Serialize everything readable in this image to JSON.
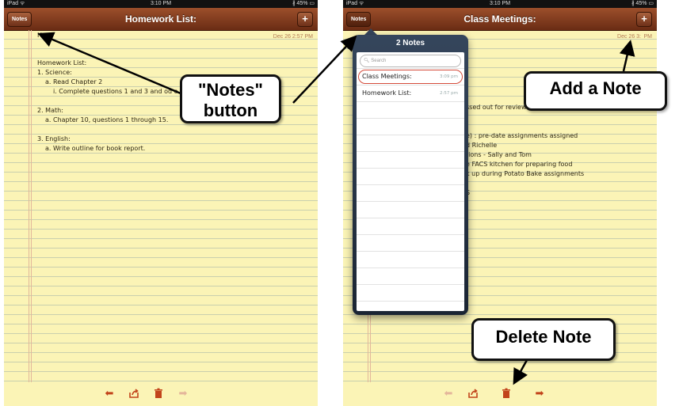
{
  "status": {
    "carrier": "iPad ᯤ",
    "time": "3:10 PM",
    "battery": "∦ 45% ▭"
  },
  "left": {
    "title": "Homework List:",
    "notes_button": "Notes",
    "add_button": "+",
    "date": "Dec 26  2:57 PM",
    "first_line": "H",
    "lines": [
      {
        "text": "Homework List:",
        "indent": 0
      },
      {
        "text": "1. Science:",
        "indent": 0
      },
      {
        "text": "a. Read Chapter 2",
        "indent": 1
      },
      {
        "text": "i. Complete questions 1 and 3 and od o",
        "indent": 2
      },
      {
        "text": "",
        "indent": 0
      },
      {
        "text": "2. Math:",
        "indent": 0
      },
      {
        "text": "a. Chapter 10, questions 1 through 15.",
        "indent": 1
      },
      {
        "text": "",
        "indent": 0
      },
      {
        "text": "3. English:",
        "indent": 0
      },
      {
        "text": "a. Write outline for book report.",
        "indent": 1
      }
    ]
  },
  "right": {
    "title": "Class Meetings:",
    "notes_button": "Notes",
    "add_button": "+",
    "date": "Dec 26  3:",
    "date_tail": "PM",
    "visible_fragments": [
      "ssed out for review",
      "",
      "",
      "e) : pre-date assignments assigned",
      "d Richelle",
      "tions - Sally and Tom",
      "e FACS kitchen for preparing food",
      "k up during Potato Bake assignments",
      "",
      "S"
    ],
    "popover": {
      "title": "2 Notes",
      "search_placeholder": "Search",
      "items": [
        {
          "title": "Class Meetings:",
          "time": "3:09 pm"
        },
        {
          "title": "Homework List:",
          "time": "2:57 pm"
        }
      ]
    }
  },
  "icons": [
    "back-arrow-icon",
    "share-icon",
    "trash-icon",
    "forward-arrow-icon"
  ],
  "callouts": {
    "notes_button": {
      "line1": "\"Notes\"",
      "line2": "button"
    },
    "add_note": "Add a Note",
    "delete_note": "Delete Note"
  },
  "colors": {
    "toolbar": "#7e3a1e",
    "paper": "#fbf4b6",
    "popover": "#2b3a4e",
    "icon": "#c2441b",
    "callout_border": "#111111"
  }
}
